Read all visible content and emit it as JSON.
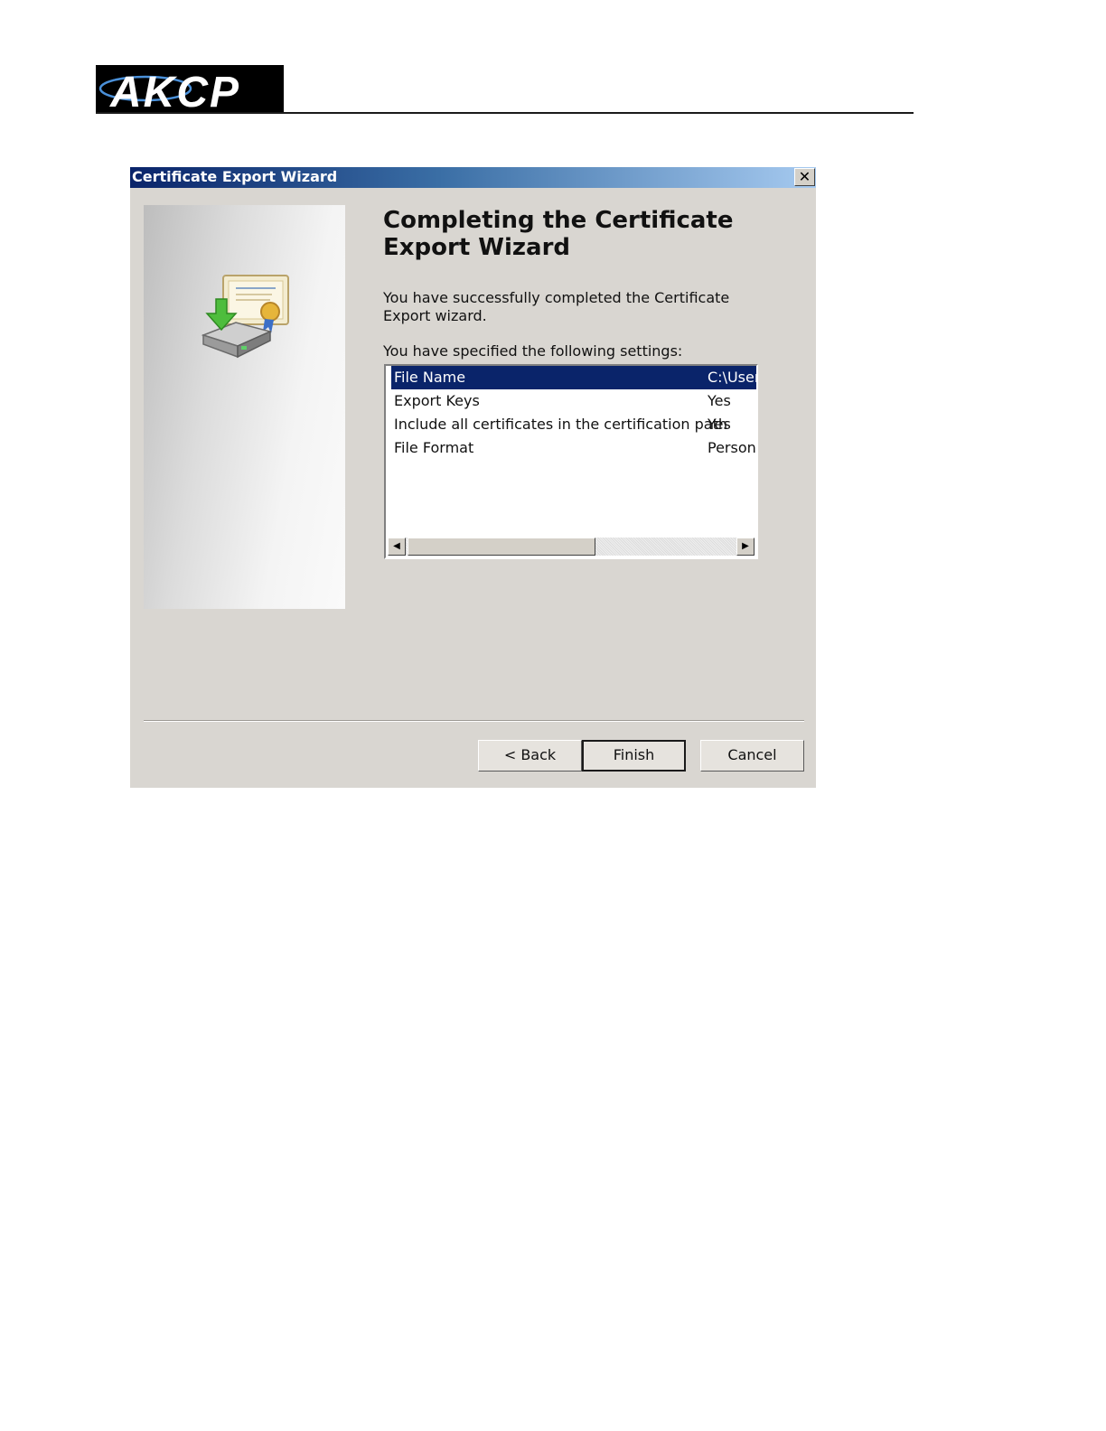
{
  "page_header": {
    "logo_text": "AKCP"
  },
  "dialog": {
    "title": "Certificate Export Wizard",
    "close_glyph": "✕",
    "heading": "Completing the Certificate Export Wizard",
    "success_text": "You have successfully completed the Certificate Export wizard.",
    "settings_label": "You have specified the following settings:",
    "settings": [
      {
        "name": "File Name",
        "value": "C:\\User",
        "selected": true
      },
      {
        "name": "Export Keys",
        "value": "Yes",
        "selected": false
      },
      {
        "name": "Include all certificates in the certification path",
        "value": "Yes",
        "selected": false
      },
      {
        "name": "File Format",
        "value": "Persona",
        "selected": false
      }
    ],
    "scroll_left_glyph": "◀",
    "scroll_right_glyph": "▶",
    "buttons": {
      "back": "< Back",
      "finish": "Finish",
      "cancel": "Cancel"
    }
  },
  "colors": {
    "selection": "#0a246a",
    "dialog_background": "#d9d6d1",
    "title_gradient_start": "#0a246a",
    "title_gradient_end": "#a6caf0"
  },
  "icons": {
    "wizard_graphic": "certificate-export-icon",
    "close": "close-icon",
    "scroll_left": "scroll-left-icon",
    "scroll_right": "scroll-right-icon"
  }
}
